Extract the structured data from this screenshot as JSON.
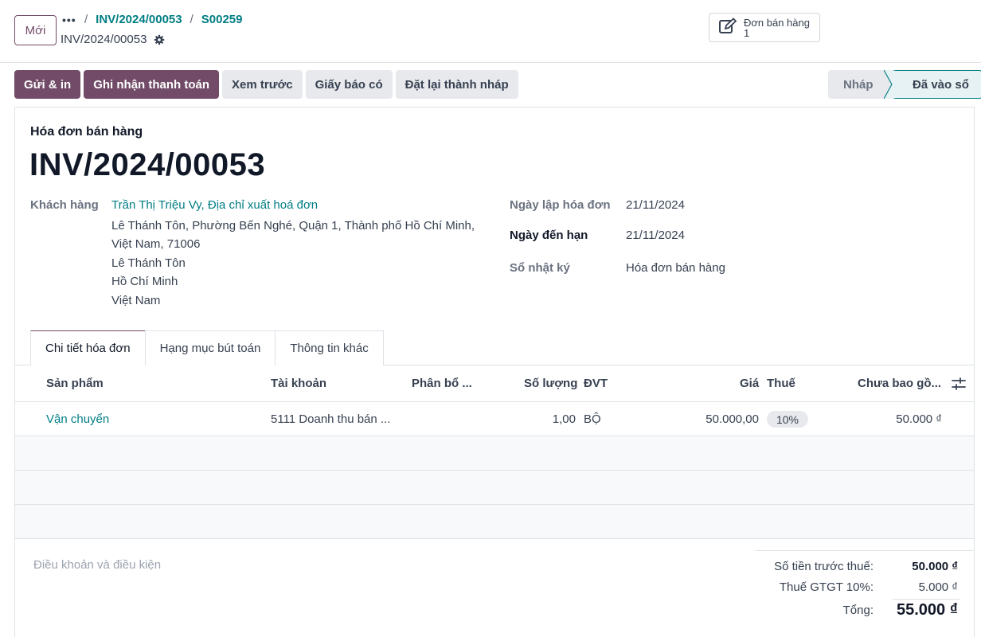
{
  "control_panel": {
    "new_button": "Mới",
    "breadcrumbs": [
      "INV/2024/00053",
      "S00259"
    ],
    "current_record": "INV/2024/00053",
    "smart_button": {
      "label": "Đơn bán hàng",
      "count": "1"
    }
  },
  "actions": [
    "Gửi & in",
    "Ghi nhận thanh toán",
    "Xem trước",
    "Giấy báo có",
    "Đặt lại thành nháp"
  ],
  "status": {
    "draft": "Nháp",
    "posted": "Đã vào sổ"
  },
  "invoice": {
    "type": "Hóa đơn bán hàng",
    "name": "INV/2024/00053",
    "customer_label": "Khách hàng",
    "customer_name": "Trần Thị Triệu Vy, Địa chỉ xuất hoá đơn",
    "address_lines": [
      "Lê Thánh Tôn, Phường Bến Nghé, Quận 1, Thành phố Hồ Chí Minh,",
      "Việt Nam, 71006",
      "Lê Thánh Tôn",
      "Hồ Chí Minh",
      "Việt Nam"
    ],
    "invoice_date_label": "Ngày lập hóa đơn",
    "invoice_date": "21/11/2024",
    "due_date_label": "Ngày đến hạn",
    "due_date": "21/11/2024",
    "journal_label": "Sổ nhật ký",
    "journal": "Hóa đơn bán hàng"
  },
  "tabs": [
    "Chi tiết hóa đơn",
    "Hạng mục bút toán",
    "Thông tin khác"
  ],
  "table": {
    "headers": {
      "product": "Sản phẩm",
      "account": "Tài khoản",
      "analytic": "Phân bổ ...",
      "quantity": "Số lượng",
      "uom": "ĐVT",
      "price": "Giá",
      "tax": "Thuế",
      "subtotal": "Chưa bao gồ..."
    },
    "rows": [
      {
        "product": "Vận chuyển",
        "account": "5111 Doanh thu bán ...",
        "quantity": "1,00",
        "uom": "BỘ",
        "price": "50.000,00",
        "tax": "10%",
        "subtotal": "50.000 ₫"
      }
    ]
  },
  "terms_placeholder": "Điều khoản và điều kiện",
  "totals": {
    "untaxed_label": "Số tiền trước thuế:",
    "untaxed": "50.000 ₫",
    "vat_label": "Thuế GTGT 10%:",
    "vat": "5.000 ₫",
    "total_label": "Tổng:",
    "total": "55.000 ₫"
  },
  "colors": {
    "brand": "#714b67",
    "link": "#017e84"
  }
}
